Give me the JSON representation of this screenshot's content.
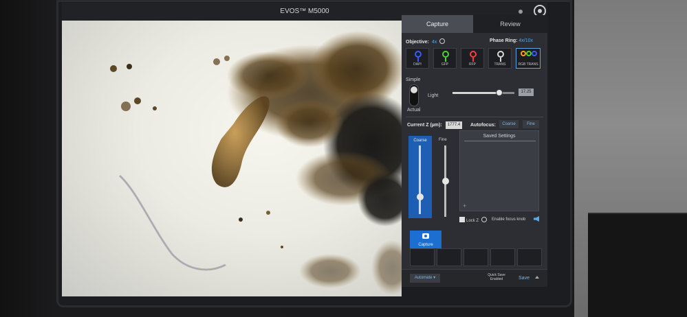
{
  "app": {
    "title": "EVOS™ M5000"
  },
  "tabs": [
    {
      "label": "Capture"
    },
    {
      "label": "Review"
    }
  ],
  "objective": {
    "label": "Objective:",
    "value": "4x"
  },
  "phase_ring": {
    "label": "Phase Ring:",
    "value": "4x/10x"
  },
  "channels": [
    {
      "label": "DAPI",
      "color": "#3b5bff"
    },
    {
      "label": "GFP",
      "color": "#4cd137"
    },
    {
      "label": "RFP",
      "color": "#ff3b3b"
    },
    {
      "label": "TRANS",
      "color": "#d8d8d8"
    },
    {
      "label": "RGB TRANS",
      "color": "#ff9f1a"
    }
  ],
  "light": {
    "mode_top": "Simple",
    "mode_bottom": "Actual",
    "label": "Light",
    "value": "17.25",
    "level_fraction": 0.75
  },
  "z": {
    "label": "Current Z (µm):",
    "value": "1777.4"
  },
  "autofocus": {
    "label": "Autofocus:",
    "coarse_btn": "Coarse",
    "fine_btn": "Fine"
  },
  "focus": {
    "coarse_label": "Coarse",
    "fine_label": "Fine",
    "coarse_fraction": 0.25,
    "fine_fraction": 0.5
  },
  "saved_settings": {
    "title": "Saved Settings",
    "add": "+"
  },
  "lock_z": {
    "label": "Lock Z"
  },
  "enable_focus": {
    "label": "Enable focus knob"
  },
  "capture_button": {
    "label": "Capture"
  },
  "footer": {
    "automate": "Automate ▾",
    "quick_save_line1": "Quick Save",
    "quick_save_line2": "Enabled",
    "save": "Save"
  }
}
